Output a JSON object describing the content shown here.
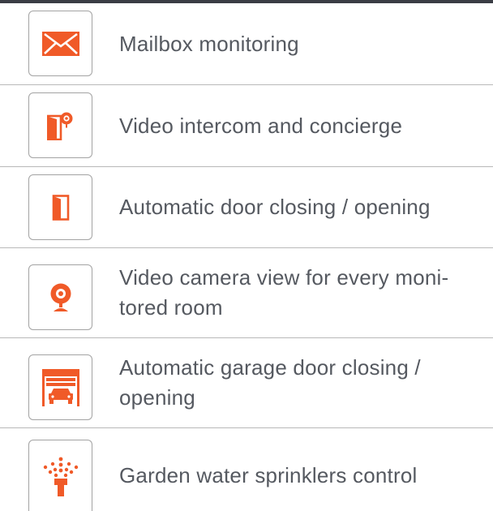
{
  "accent_color": "#f05a28",
  "features": [
    {
      "icon": "envelope-icon",
      "label": "Mailbox monitoring"
    },
    {
      "icon": "intercom-door-icon",
      "label": "Video intercom and concierge"
    },
    {
      "icon": "door-icon",
      "label": "Automatic door closing / opening"
    },
    {
      "icon": "webcam-icon",
      "label": "Video camera view for every moni-tored room"
    },
    {
      "icon": "garage-car-icon",
      "label": "Automatic garage door closing / opening"
    },
    {
      "icon": "sprinkler-icon",
      "label": "Garden water sprinklers control"
    }
  ]
}
